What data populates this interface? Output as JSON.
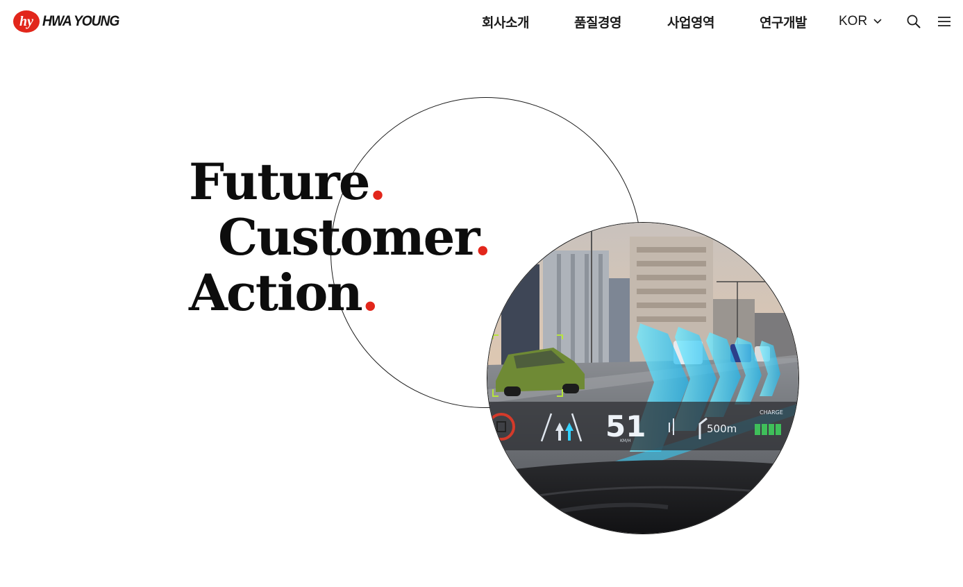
{
  "header": {
    "logo": {
      "mark_text": "hy",
      "wordmark": "HWA YOUNG"
    },
    "nav": [
      {
        "label": "회사소개"
      },
      {
        "label": "품질경영"
      },
      {
        "label": "사업영역"
      },
      {
        "label": "연구개발"
      }
    ],
    "language": {
      "selected": "KOR",
      "icon": "chevron-down-icon"
    },
    "search_icon": "search-icon",
    "menu_icon": "hamburger-menu-icon"
  },
  "hero": {
    "lines": [
      {
        "word": "Future",
        "dot": "."
      },
      {
        "word": "Customer",
        "dot": "."
      },
      {
        "word": "Action",
        "dot": "."
      }
    ],
    "image": {
      "hud": {
        "speed": "51",
        "speed_unit": "KM/H",
        "distance": "500m",
        "charge_label": "CHARGE"
      }
    }
  },
  "colors": {
    "accent": "#e2261b",
    "text": "#111111",
    "hud": "#32d2ff"
  }
}
